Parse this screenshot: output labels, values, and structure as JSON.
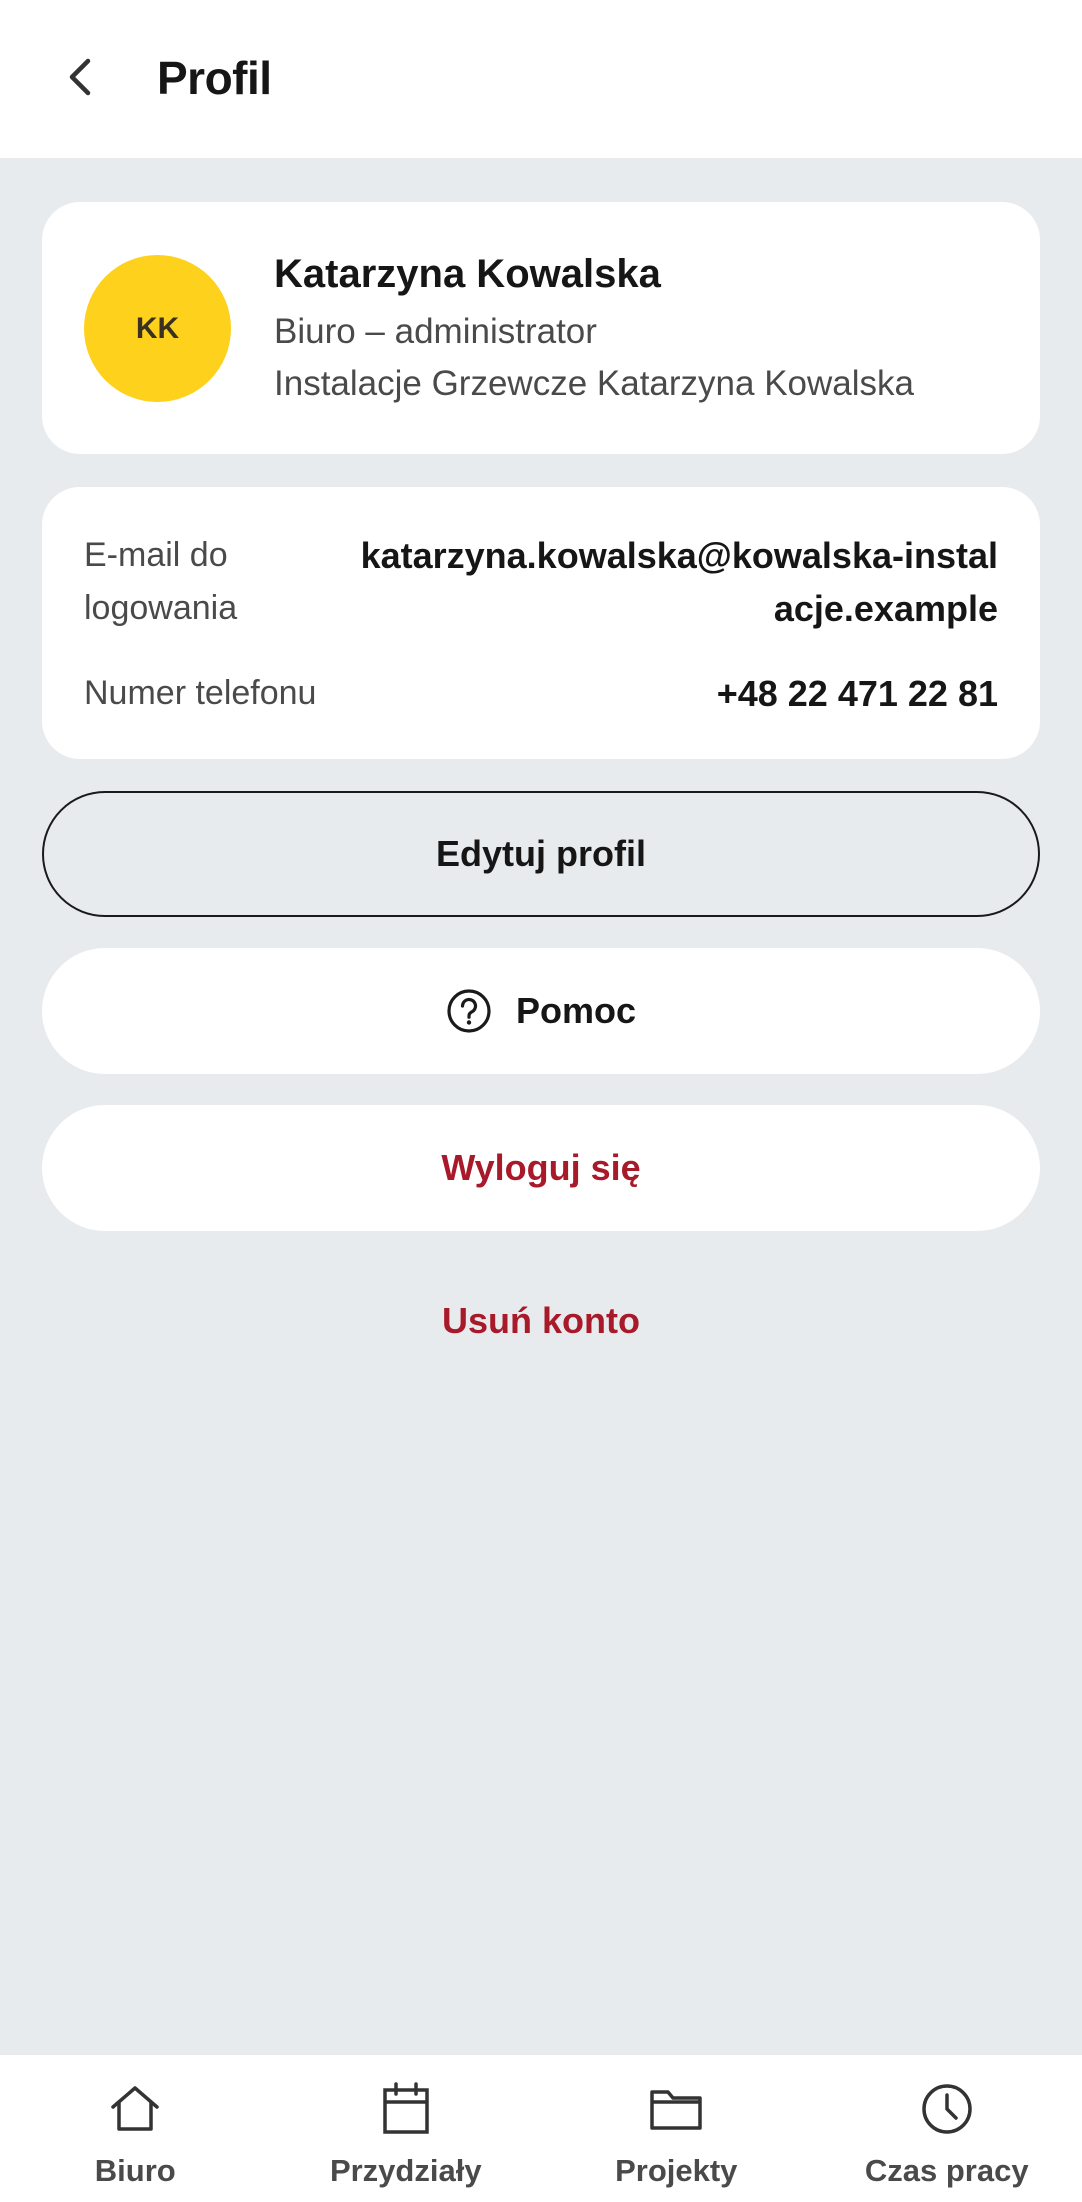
{
  "header": {
    "title": "Profil",
    "back_icon": "chevron-left-icon"
  },
  "profile": {
    "initials": "KK",
    "avatar_color": "#fdd11c",
    "name": "Katarzyna Kowalska",
    "role": "Biuro – administrator",
    "company": "Instalacje Grzewcze Katarzyna Kowalska"
  },
  "details": {
    "email_label": "E-mail do logowania",
    "email_value": "katarzyna.kowalska@kowalska-instalacje.example",
    "phone_label": "Numer telefonu",
    "phone_value": "+48 22 471 22 81"
  },
  "actions": {
    "edit_label": "Edytuj profil",
    "help_label": "Pomoc",
    "help_icon": "question-circle-icon",
    "logout_label": "Wyloguj się",
    "delete_label": "Usuń konto",
    "danger_color": "#a8192a"
  },
  "bottom_nav": {
    "items": [
      {
        "label": "Biuro",
        "icon": "home-icon"
      },
      {
        "label": "Przydziały",
        "icon": "calendar-icon"
      },
      {
        "label": "Projekty",
        "icon": "folder-icon"
      },
      {
        "label": "Czas pracy",
        "icon": "clock-icon"
      }
    ]
  }
}
